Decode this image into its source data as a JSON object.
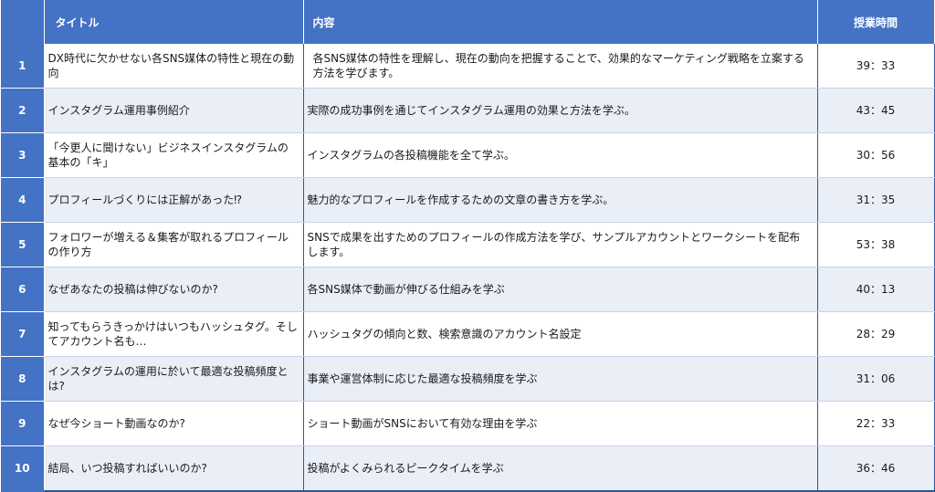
{
  "header": {
    "no": "",
    "title": "タイトル",
    "content": "内容",
    "time": "授業時間"
  },
  "rows": [
    {
      "no": "1",
      "title": "DX時代に欠かせない各SNS媒体の特性と現在の動向",
      "content": "各SNS媒体の特性を理解し、現在の動向を把握することで、効果的なマーケティング戦略を立案する方法を学びます。",
      "time": "39：33"
    },
    {
      "no": "2",
      "title": "インスタグラム運用事例紹介",
      "content": "実際の成功事例を通じてインスタグラム運用の効果と方法を学ぶ。",
      "time": "43：45"
    },
    {
      "no": "3",
      "title": "「今更人に聞けない」ビジネスインスタグラムの基本の「キ」",
      "content": "インスタグラムの各投稿機能を全て学ぶ。",
      "time": "30：56"
    },
    {
      "no": "4",
      "title": "プロフィールづくりには正解があった⁉",
      "content": "魅力的なプロフィールを作成するための文章の書き方を学ぶ。",
      "time": "31：35"
    },
    {
      "no": "5",
      "title": "フォロワーが増える＆集客が取れるプロフィールの作り方",
      "content": "SNSで成果を出すためのプロフィールの作成方法を学び、サンプルアカウントとワークシートを配布します。",
      "time": "53：38"
    },
    {
      "no": "6",
      "title": "なぜあなたの投稿は伸びないのか?",
      "content": "各SNS媒体で動画が伸びる仕組みを学ぶ",
      "time": "40：13"
    },
    {
      "no": "7",
      "title": "知ってもらうきっかけはいつもハッシュタグ。そしてアカウント名も…",
      "content": "ハッシュタグの傾向と数、検索意識のアカウント名設定",
      "time": "28：29"
    },
    {
      "no": "8",
      "title": "インスタグラムの運用に於いて最適な投稿頻度とは?",
      "content": "事業や運営体制に応じた最適な投稿頻度を学ぶ",
      "time": "31：06"
    },
    {
      "no": "9",
      "title": "なぜ今ショート動画なのか?",
      "content": "ショート動画がSNSにおいて有効な理由を学ぶ",
      "time": "22：33"
    },
    {
      "no": "10",
      "title": "結局、いつ投稿すればいいのか?",
      "content": "投稿がよくみられるピークタイムを学ぶ",
      "time": "36：46"
    }
  ]
}
